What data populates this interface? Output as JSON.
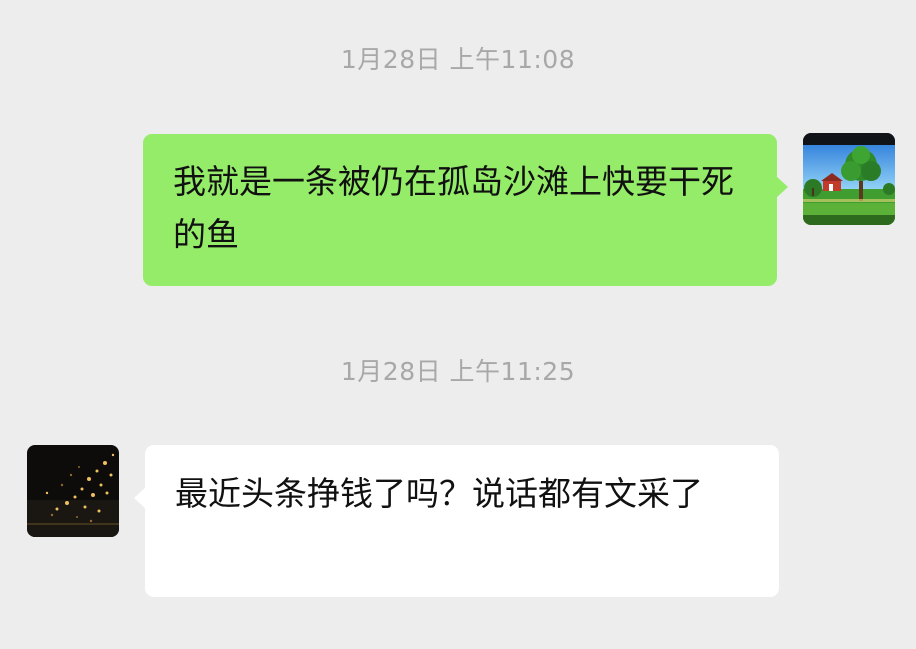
{
  "messages": [
    {
      "timestamp": "1月28日 上午11:08",
      "sender": "self",
      "text": "我就是一条被仍在孤岛沙滩上快要干死的鱼",
      "avatar": "farm-landscape-avatar"
    },
    {
      "timestamp": "1月28日 上午11:25",
      "sender": "other",
      "text": "最近头条挣钱了吗？说话都有文采了",
      "avatar": "night-lights-avatar"
    }
  ],
  "colors": {
    "background": "#ededed",
    "sent_bubble": "#95ec69",
    "received_bubble": "#ffffff",
    "timestamp_text": "#a8a8a8",
    "message_text": "#111111"
  }
}
